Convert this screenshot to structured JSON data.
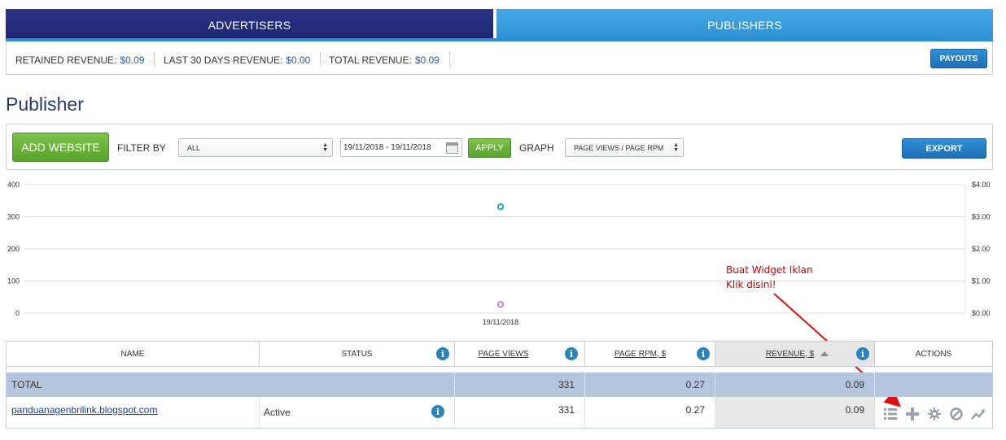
{
  "tabs": {
    "advertisers": "ADVERTISERS",
    "publishers": "PUBLISHERS"
  },
  "revenue": {
    "retained_label": "RETAINED REVENUE:",
    "retained_value": "$0.09",
    "last30_label": "LAST 30 DAYS REVENUE:",
    "last30_value": "$0.00",
    "total_label": "TOTAL REVENUE:",
    "total_value": "$0.09",
    "payouts_label": "PAYOUTS"
  },
  "page_title": "Publisher",
  "toolbar": {
    "add_website_label": "ADD WEBSITE",
    "filter_by_label": "FILTER BY",
    "filter_value": "ALL",
    "date_range": "19/11/2018 - 19/11/2018",
    "apply_label": "APPLY",
    "graph_label": "GRAPH",
    "graph_value": "PAGE VIEWS / PAGE RPM",
    "export_label": "EXPORT"
  },
  "chart_data": {
    "type": "scatter",
    "categories": [
      "19/11/2018"
    ],
    "series": [
      {
        "values": [
          331
        ],
        "color": "#1ab5a8",
        "axis": "left"
      },
      {
        "values": [
          0.27
        ],
        "color": "#d07fd8",
        "axis": "right"
      }
    ],
    "left_ticks": [
      "0",
      "100",
      "200",
      "300",
      "400"
    ],
    "right_ticks": [
      "$0.00",
      "$1.00",
      "$2.00",
      "$3.00",
      "$4.00"
    ],
    "ylim_left": [
      0,
      400
    ],
    "ylim_right": [
      0,
      4
    ],
    "grid": true
  },
  "annotation": {
    "line1": "Buat Widget Iklan",
    "line2": "Klik disini!",
    "color": "#cc0000"
  },
  "table": {
    "headers": {
      "name": "NAME",
      "status": "STATUS",
      "page_views": "PAGE VIEWS",
      "page_rpm": "PAGE RPM, $",
      "revenue": "REVENUE, $",
      "actions": "ACTIONS"
    },
    "total": {
      "name": "TOTAL",
      "page_views": "331",
      "page_rpm": "0.27",
      "revenue": "0.09"
    },
    "rows": [
      {
        "name": "panduanagenbrilink.blogspot.com",
        "status": "Active",
        "page_views": "331",
        "page_rpm": "0.27",
        "revenue": "0.09"
      }
    ]
  },
  "colors": {
    "advertisers_tab": "#1d2670",
    "publishers_tab": "#2d8fd4",
    "green_button": "#58a32c",
    "blue_button": "#1d6fb8",
    "total_row": "#b5c5de"
  }
}
